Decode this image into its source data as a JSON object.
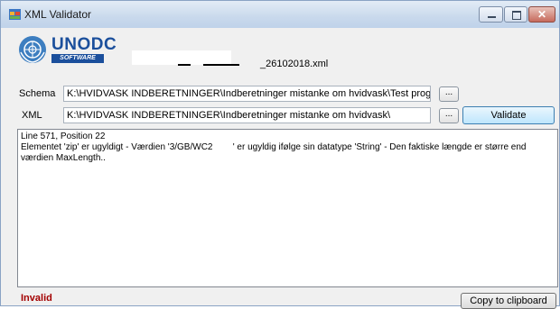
{
  "window": {
    "title": "XML Validator"
  },
  "logo": {
    "brand": "UNODC",
    "sub": "SOFTWARE"
  },
  "file": {
    "name": "_26102018.xml"
  },
  "schema": {
    "label": "Schema",
    "path": "K:\\HVIDVASK INDBERETNINGER\\Indberetninger mistanke om hvidvask\\Test progr",
    "browse_label": "..."
  },
  "xml": {
    "label": "XML",
    "path": "K:\\HVIDVASK INDBERETNINGER\\Indberetninger mistanke om hvidvask\\",
    "browse_label": "...",
    "validate_label": "Validate"
  },
  "output": {
    "lines": [
      "Line 571, Position 22",
      "Elementet 'zip' er ugyldigt - Værdien '3/GB/WC2        ' er ugyldig ifølge sin datatype 'String' - Den faktiske længde er større end",
      "værdien MaxLength.."
    ]
  },
  "status": {
    "text": "Invalid",
    "color": "#a30000"
  },
  "copy_label": "Copy to clipboard",
  "icons": {
    "app": "app-window-icon",
    "minimize": "minimize-icon",
    "maximize": "maximize-icon",
    "close": "close-icon",
    "logo": "un-emblem-icon"
  }
}
